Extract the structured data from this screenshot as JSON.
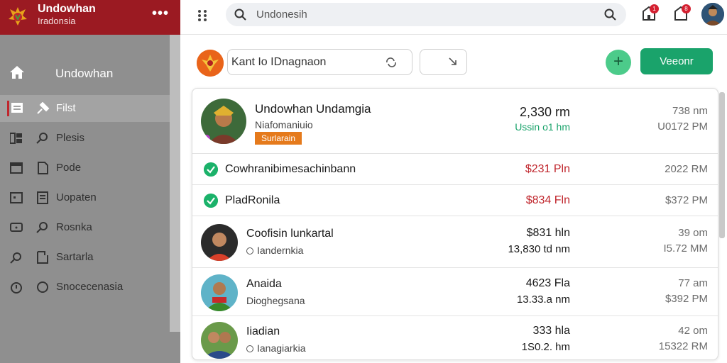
{
  "brand": {
    "name": "Undowhan",
    "subtitle": "Iradonsia",
    "more": "•••"
  },
  "sidebar": {
    "home": "Undowhan",
    "items": [
      {
        "label": "Filst",
        "active": true
      },
      {
        "label": "Plesis",
        "active": false
      },
      {
        "label": "Pode",
        "active": false
      },
      {
        "label": "Uopaten",
        "active": false
      },
      {
        "label": "Rosnka",
        "active": false
      },
      {
        "label": "Sartarla",
        "active": false
      },
      {
        "label": "Snocecenasia",
        "active": false
      }
    ]
  },
  "topbar": {
    "search_value": "Undonesih",
    "notif_1_badge": "1",
    "notif_2_badge": "8"
  },
  "toolbar": {
    "field_value": "Kant Io IDnagnaon",
    "primary_label": "Veeonr",
    "add_label": "+"
  },
  "list": {
    "header": {
      "name": "Undowhan Undamgia",
      "sub": "Niafomaniuio",
      "tag": "Surlarain",
      "val1": "2,330 rm",
      "val2": "Ussin o1 hm",
      "val3": "738 nm",
      "val4": "U0172 PM"
    },
    "check_rows": [
      {
        "name": "Cowhranibimesachinbann",
        "amount": "$231 Pln",
        "time": "2022 RM"
      },
      {
        "name": "PladRonila",
        "amount": "$834 Fln",
        "time": "$372 PM"
      }
    ],
    "people": [
      {
        "name": "Coofisin lunkartal",
        "sub": "Iandernkia",
        "has_pin": true,
        "val1": "$831 hln",
        "val2": "13,830 td nm",
        "val3": "39 om",
        "val4": "I5.72 MM"
      },
      {
        "name": "Anaida",
        "sub": "Dioghegsana",
        "has_pin": false,
        "val1": "4623 Fla",
        "val2": "13.33.a nm",
        "val3": "77 am",
        "val4": "$392 PM"
      },
      {
        "name": "Iiadian",
        "sub": "Ianagiarkia",
        "has_pin": true,
        "val1": "333 hla",
        "val2": "1S0.2. hm",
        "val3": "42 om",
        "val4": "15322 RM"
      }
    ]
  },
  "colors": {
    "brand_red": "#9b1a22",
    "sidebar_gray": "#8f8f8f",
    "success_green": "#1aa36b",
    "amount_red": "#c0262d",
    "tag_orange": "#e57a1c"
  },
  "icons": {
    "brand": "emblem-icon",
    "home": "home-icon",
    "grid": "grid-icon",
    "search": "search-icon",
    "notifications": "bell-icon",
    "check": "check-circle-icon",
    "pin": "location-pin-icon"
  }
}
